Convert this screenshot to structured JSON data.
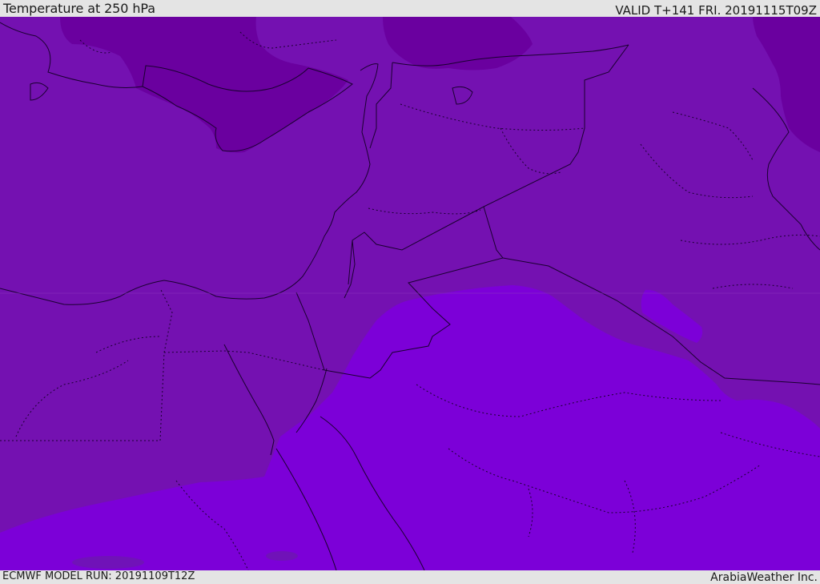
{
  "header": {
    "title": "Temperature at 250 hPa",
    "valid": "VALID T+141 FRI. 20191115T09Z"
  },
  "footer": {
    "model_run": "ECMWF MODEL RUN: 20191109T12Z",
    "credit": "ArabiaWeather Inc."
  },
  "colors": {
    "band_coldest": "#6a009f",
    "band_mid": "#7411b1",
    "band_warm": "#7c00d8",
    "border_line": "#1a0030",
    "frame_bg": "#e4e4e4"
  }
}
